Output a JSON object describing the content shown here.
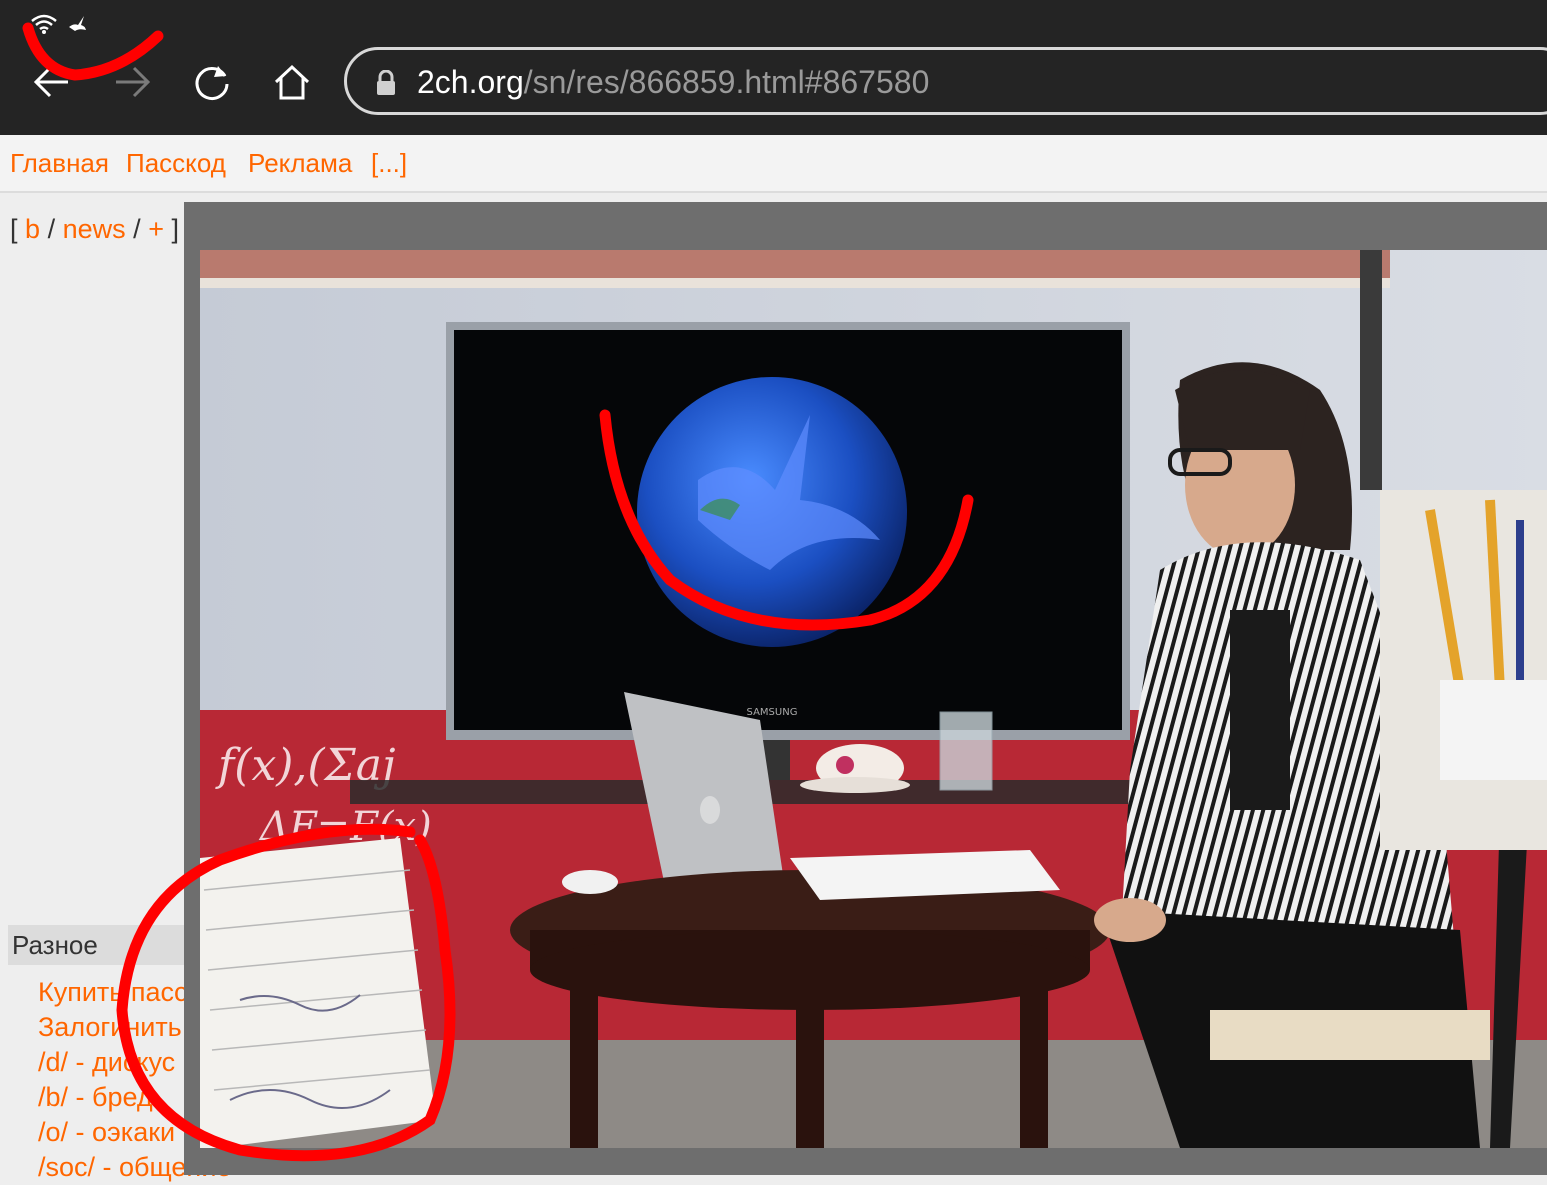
{
  "browser": {
    "url_host": "2ch.org",
    "url_path": "/sn/res/866859.html#867580"
  },
  "nav": {
    "items": [
      "Главная",
      "Пасскод",
      "Реклама",
      "[...]"
    ]
  },
  "boards": {
    "open": "[",
    "items": [
      "b",
      "news",
      "+"
    ],
    "sep": "/",
    "close": "]"
  },
  "sidebar": {
    "header": "Разное",
    "items": [
      "Купить пасс",
      "Залогинить",
      "/d/ - дискус",
      "/b/ - бред",
      "/o/ - оэкаки",
      "/soc/ - общение"
    ]
  },
  "video": {
    "tv_brand": "SAMSUNG"
  },
  "colors": {
    "accent": "#ff6600",
    "annotation": "#ff0000",
    "chrome": "#242424"
  },
  "icons": [
    "wifi-icon",
    "dove-icon",
    "back-arrow-icon",
    "forward-arrow-icon",
    "reload-icon",
    "home-icon",
    "lock-icon"
  ]
}
